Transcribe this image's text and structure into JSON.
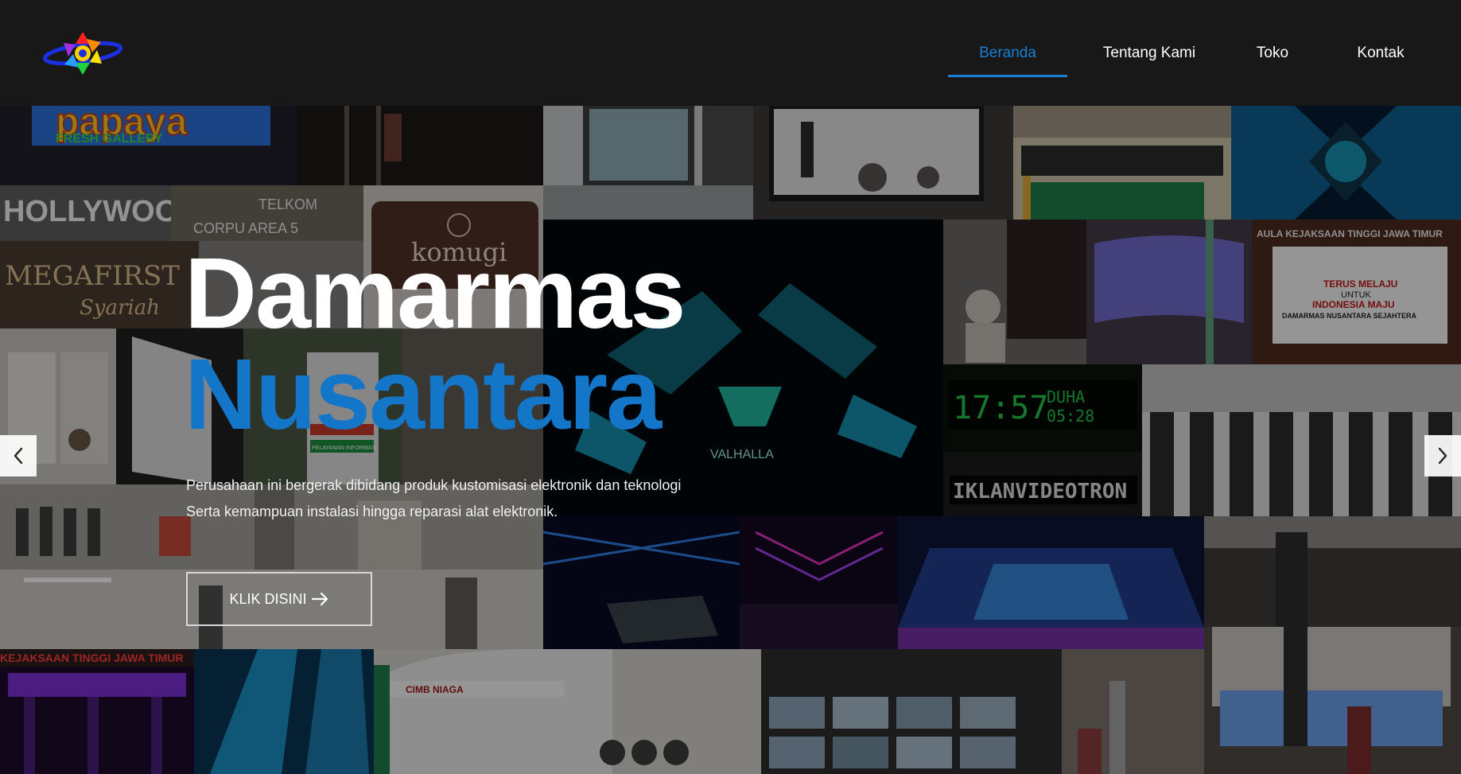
{
  "nav": {
    "items": [
      {
        "label": "Beranda",
        "active": true
      },
      {
        "label": "Tentang Kami",
        "active": false
      },
      {
        "label": "Toko",
        "active": false
      },
      {
        "label": "Kontak",
        "active": false
      }
    ],
    "active_color": "#1a7fd0"
  },
  "hero": {
    "title_line1": "Damarmas",
    "title_line2": "Nusantara",
    "title_line2_color": "#1476c9",
    "description_line1": "Perusahaan ini bergerak dibidang produk kustomisasi elektronik dan teknologi",
    "description_line2": "Serta kemampuan instalasi hingga reparasi alat elektronik.",
    "cta_label": "KLIK DISINI",
    "cta_icon": "arrow-right-icon"
  },
  "collage": {
    "sign_papaya": "papaya",
    "sign_fresh_gallery": "FRESH GALLERY",
    "sign_hollywood": "HOLLYWOOD",
    "sign_telkom": "TELKOM",
    "sign_corpu": "CORPU AREA 5",
    "sign_megafirst": "MEGAFIRST",
    "sign_syariah": "Syariah",
    "sign_komugi": "komugi",
    "sign_kejaksaan_top": "AULA KEJAKSAAN TINGGI JAWA TIMUR",
    "screen_terus": "TERUS MELAJU",
    "screen_untuk": "UNTUK",
    "screen_indonesia": "INDONESIA MAJU",
    "screen_company": "DAMARMAS NUSANTARA SEJAHTERA",
    "led_time": "17:57",
    "led_duha": "DUHA",
    "led_duha_time": "05:28",
    "led_running": "IKLANVIDEOTRON",
    "sign_kejaksaan_bottom": "KEJAKSAAN TINGGI JAWA TIMUR",
    "sign_cimb": "CIMB NIAGA",
    "sign_valhalla": "VALHALLA",
    "sign_pelayanan": "PELAYANAN INFORMASI"
  }
}
